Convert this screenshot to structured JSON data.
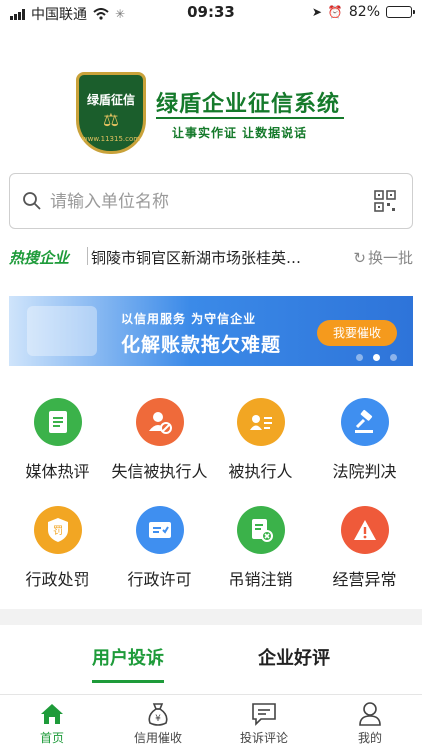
{
  "status_bar": {
    "carrier": "中国联通",
    "time": "09:33",
    "battery_percent": "82%",
    "battery_level": 0.82
  },
  "brand": {
    "shield_text": "绿盾征信",
    "shield_url": "www.11315.com",
    "title": "绿盾企业征信系统",
    "slogan": "让事实作证  让数据说话"
  },
  "search": {
    "placeholder": "请输入单位名称"
  },
  "hot": {
    "label": "热搜企业",
    "text": "铜陵市铜官区新湖市场张桂英…",
    "refresh_label": "换一批"
  },
  "banner": {
    "subtitle": "以信用服务  为守信企业",
    "title": "化解账款拖欠难题",
    "button": "我要催收",
    "active_dot": 1
  },
  "grid": {
    "items": [
      {
        "label": "媒体热评",
        "color": "#3bb24a",
        "icon": "document-icon"
      },
      {
        "label": "失信被执行人",
        "color": "#ef6a3a",
        "icon": "person-banned-icon"
      },
      {
        "label": "被执行人",
        "color": "#f2a623",
        "icon": "id-card-icon"
      },
      {
        "label": "法院判决",
        "color": "#3f8ff0",
        "icon": "gavel-icon"
      },
      {
        "label": "行政处罚",
        "color": "#f2a623",
        "icon": "penalty-badge-icon"
      },
      {
        "label": "行政许可",
        "color": "#3f8ff0",
        "icon": "license-card-icon"
      },
      {
        "label": "吊销注销",
        "color": "#3bb24a",
        "icon": "revoke-doc-icon"
      },
      {
        "label": "经营异常",
        "color": "#ef5a3a",
        "icon": "warning-icon"
      }
    ]
  },
  "tabs": [
    {
      "label": "用户投诉",
      "active": true
    },
    {
      "label": "企业好评",
      "active": false
    }
  ],
  "bottom_nav": [
    {
      "label": "首页",
      "active": true,
      "icon": "home-icon"
    },
    {
      "label": "信用催收",
      "active": false,
      "icon": "money-bag-icon"
    },
    {
      "label": "投诉评论",
      "active": false,
      "icon": "comment-icon"
    },
    {
      "label": "我的",
      "active": false,
      "icon": "user-icon"
    }
  ],
  "colors": {
    "brand_green": "#157a2b",
    "accent_green": "#1e9b3a"
  }
}
